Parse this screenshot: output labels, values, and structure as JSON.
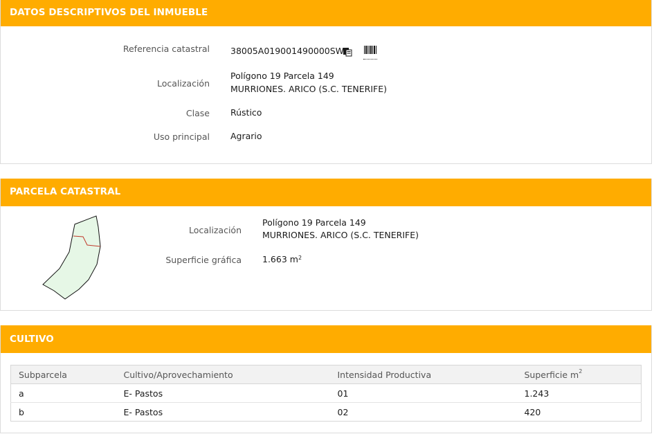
{
  "descriptivos": {
    "header": "DATOS DESCRIPTIVOS DEL INMUEBLE",
    "ref_label": "Referencia catastral",
    "ref_value": "38005A019001490000SW",
    "loc_label": "Localización",
    "loc_line1": "Polígono 19 Parcela 149",
    "loc_line2": "MURRIONES. ARICO (S.C. TENERIFE)",
    "clase_label": "Clase",
    "clase_value": "Rústico",
    "uso_label": "Uso principal",
    "uso_value": "Agrario",
    "icons": [
      "copy-icon",
      "barcode-icon"
    ]
  },
  "parcela": {
    "header": "PARCELA CATASTRAL",
    "loc_label": "Localización",
    "loc_line1": "Polígono 19 Parcela 149",
    "loc_line2": "MURRIONES. ARICO (S.C. TENERIFE)",
    "sup_label": "Superficie gráfica",
    "sup_value": "1.663 m",
    "sup_unit_exp": "2",
    "map_colors": {
      "fill": "#e6f7e6",
      "outline": "#111111",
      "division": "#c0392b"
    }
  },
  "cultivo": {
    "header": "CULTIVO",
    "columns": [
      "Subparcela",
      "Cultivo/Aprovechamiento",
      "Intensidad Productiva",
      "Superficie m"
    ],
    "last_col_exp": "2",
    "rows": [
      [
        "a",
        "E- Pastos",
        "01",
        "1.243"
      ],
      [
        "b",
        "E- Pastos",
        "02",
        "420"
      ]
    ]
  },
  "colors": {
    "header_bg": "#ffac00",
    "header_text": "#ffffff"
  }
}
